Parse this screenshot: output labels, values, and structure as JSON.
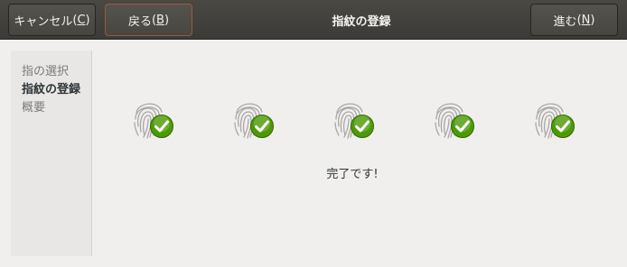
{
  "header": {
    "cancel_label": "キャンセル",
    "cancel_mnemonic": "C",
    "back_label": "戻る",
    "back_mnemonic": "B",
    "title": "指紋の登録",
    "next_label": "進む",
    "next_mnemonic": "N"
  },
  "sidebar": {
    "items": [
      {
        "label": "指の選択",
        "active": false
      },
      {
        "label": "指紋の登録",
        "active": true
      },
      {
        "label": "概要",
        "active": false
      }
    ]
  },
  "main": {
    "fingerprints": [
      {
        "icon": "fingerprint-check-icon",
        "status": "complete"
      },
      {
        "icon": "fingerprint-check-icon",
        "status": "complete"
      },
      {
        "icon": "fingerprint-check-icon",
        "status": "complete"
      },
      {
        "icon": "fingerprint-check-icon",
        "status": "complete"
      },
      {
        "icon": "fingerprint-check-icon",
        "status": "complete"
      }
    ],
    "status_text": "完了です!"
  },
  "colors": {
    "header_bg": "#3c3b37",
    "back_border": "#9a5a3c",
    "check_green": "#4e9a06"
  }
}
